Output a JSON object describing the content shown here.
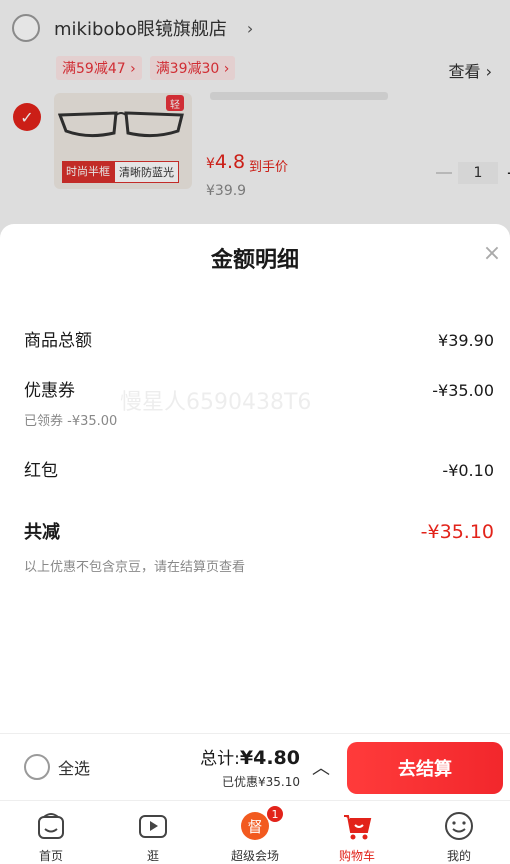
{
  "cart": {
    "shop_name": "mikibobo眼镜旗舰店",
    "shop_chevron": "›",
    "promo_tags": [
      "满59减47 ›",
      "满39减30 ›"
    ],
    "view_link": "查看 ›",
    "product": {
      "badge": "轻",
      "tags": [
        "时尚半框",
        "清晰防蓝光"
      ],
      "price_currency": "¥",
      "price_value": "4.8",
      "price_label": "到手价",
      "original_price": "¥39.9",
      "quantity": "1",
      "plus_symbol": "+"
    }
  },
  "sheet": {
    "title": "金额明细",
    "close": "×",
    "watermark": "慢星人6590438T6",
    "rows": [
      {
        "label": "商品总额",
        "value": "¥39.90"
      },
      {
        "label": "优惠券",
        "value": "-¥35.00",
        "sub": "已领券 -¥35.00"
      },
      {
        "label": "红包",
        "value": "-¥0.10"
      }
    ],
    "total": {
      "label": "共减",
      "value": "-¥35.10"
    },
    "note": "以上优惠不包含京豆，请在结算页查看"
  },
  "checkout": {
    "select_all": "全选",
    "total_prefix": "总计:",
    "total_value": "¥4.80",
    "saved": "已优惠¥35.10",
    "caret": "︿",
    "pay_button": "去结算"
  },
  "tabs": [
    {
      "label": "首页",
      "icon": "home-icon"
    },
    {
      "label": "逛",
      "icon": "video-play-icon"
    },
    {
      "label": "超级会场",
      "icon": "super-venue-icon",
      "badge": "1"
    },
    {
      "label": "购物车",
      "icon": "cart-icon",
      "active": true
    },
    {
      "label": "我的",
      "icon": "profile-icon"
    }
  ],
  "colors": {
    "accent": "#e2231a",
    "pay_button": "#f2272c"
  }
}
